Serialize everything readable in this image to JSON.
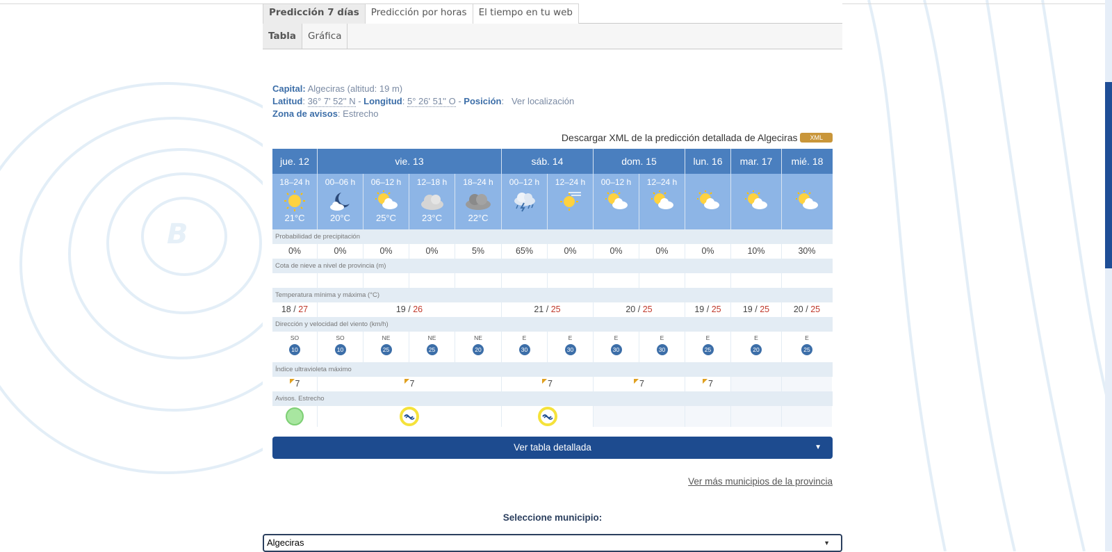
{
  "tabs_primary": [
    {
      "label": "Predicción 7 días",
      "active": true
    },
    {
      "label": "Predicción por horas",
      "active": false
    },
    {
      "label": "El tiempo en tu web",
      "active": false
    }
  ],
  "tabs_secondary": [
    {
      "label": "Tabla",
      "active": true
    },
    {
      "label": "Gráfica",
      "active": false
    }
  ],
  "location": {
    "capital_label": "Capital:",
    "capital_value": "Algeciras (altitud: 19 m)",
    "lat_label": "Latitud",
    "lat_value": "36° 7' 52'' N",
    "lon_label": "Longitud",
    "lon_value": "5° 26' 51'' O",
    "pos_label": "Posición",
    "pos_link": "Ver localización",
    "zone_label": "Zona de avisos",
    "zone_value": "Estrecho"
  },
  "download": {
    "text": "Descargar XML de la predicción detallada de Algeciras",
    "badge": "XML"
  },
  "days": [
    {
      "label": "jue. 12"
    },
    {
      "label": "vie. 13"
    },
    {
      "label": "sáb. 14"
    },
    {
      "label": "dom. 15"
    },
    {
      "label": "lun. 16"
    },
    {
      "label": "mar. 17"
    },
    {
      "label": "mié. 18"
    }
  ],
  "periods": [
    {
      "label": "18–24 h",
      "temp": "21°C",
      "icon": "sun-icon"
    },
    {
      "label": "00–06 h",
      "temp": "20°C",
      "icon": "moon-cloud-icon"
    },
    {
      "label": "06–12 h",
      "temp": "25°C",
      "icon": "sun-cloud-icon"
    },
    {
      "label": "12–18 h",
      "temp": "23°C",
      "icon": "cloud-icon"
    },
    {
      "label": "18–24 h",
      "temp": "22°C",
      "icon": "dark-cloud-icon"
    },
    {
      "label": "00–12 h",
      "temp": "",
      "icon": "storm-icon"
    },
    {
      "label": "12–24 h",
      "temp": "",
      "icon": "sun-haze-icon"
    },
    {
      "label": "00–12 h",
      "temp": "",
      "icon": "sun-cloud-icon"
    },
    {
      "label": "12–24 h",
      "temp": "",
      "icon": "sun-cloud-icon"
    },
    {
      "label": "",
      "temp": "",
      "icon": "sun-cloud-icon"
    },
    {
      "label": "",
      "temp": "",
      "icon": "sun-cloud-icon"
    },
    {
      "label": "",
      "temp": "",
      "icon": "sun-cloud-icon"
    }
  ],
  "sections": {
    "precip": "Probabilidad de precipitación",
    "snow": "Cota de nieve a nivel de provincia (m)",
    "temp": "Temperatura mínima y máxima (°C)",
    "wind": "Dirección y velocidad del viento (km/h)",
    "uv": "Índice ultravioleta máximo",
    "alerts": "Avisos. Estrecho"
  },
  "precip": [
    "0%",
    "0%",
    "0%",
    "0%",
    "5%",
    "65%",
    "0%",
    "0%",
    "0%",
    "0%",
    "10%",
    "30%"
  ],
  "temps": [
    {
      "min": "18",
      "max": "27"
    },
    {
      "min": "19",
      "max": "26"
    },
    {
      "min": "21",
      "max": "25"
    },
    {
      "min": "20",
      "max": "25"
    },
    {
      "min": "19",
      "max": "25"
    },
    {
      "min": "19",
      "max": "25"
    },
    {
      "min": "20",
      "max": "25"
    }
  ],
  "sep": "/",
  "wind": [
    {
      "dir": "SO",
      "speed": "10"
    },
    {
      "dir": "SO",
      "speed": "10"
    },
    {
      "dir": "NE",
      "speed": "25"
    },
    {
      "dir": "NE",
      "speed": "25"
    },
    {
      "dir": "NE",
      "speed": "20"
    },
    {
      "dir": "E",
      "speed": "30"
    },
    {
      "dir": "E",
      "speed": "30"
    },
    {
      "dir": "E",
      "speed": "30"
    },
    {
      "dir": "E",
      "speed": "30"
    },
    {
      "dir": "E",
      "speed": "25"
    },
    {
      "dir": "E",
      "speed": "20"
    },
    {
      "dir": "E",
      "speed": "25"
    }
  ],
  "uv": [
    "7",
    "7",
    "7",
    "7",
    "7",
    "",
    ""
  ],
  "alerts": [
    "green",
    "yellow",
    "yellow",
    "",
    "",
    "",
    ""
  ],
  "detail_button": "Ver tabla detallada",
  "more_link": "Ver más municipios de la provincia",
  "select_label": "Seleccione municipio:",
  "select_value": "Algeciras",
  "colors": {
    "header": "#4a7fbf",
    "period": "#8db5e6",
    "button": "#1d4b8f",
    "xml": "#c9963a"
  }
}
